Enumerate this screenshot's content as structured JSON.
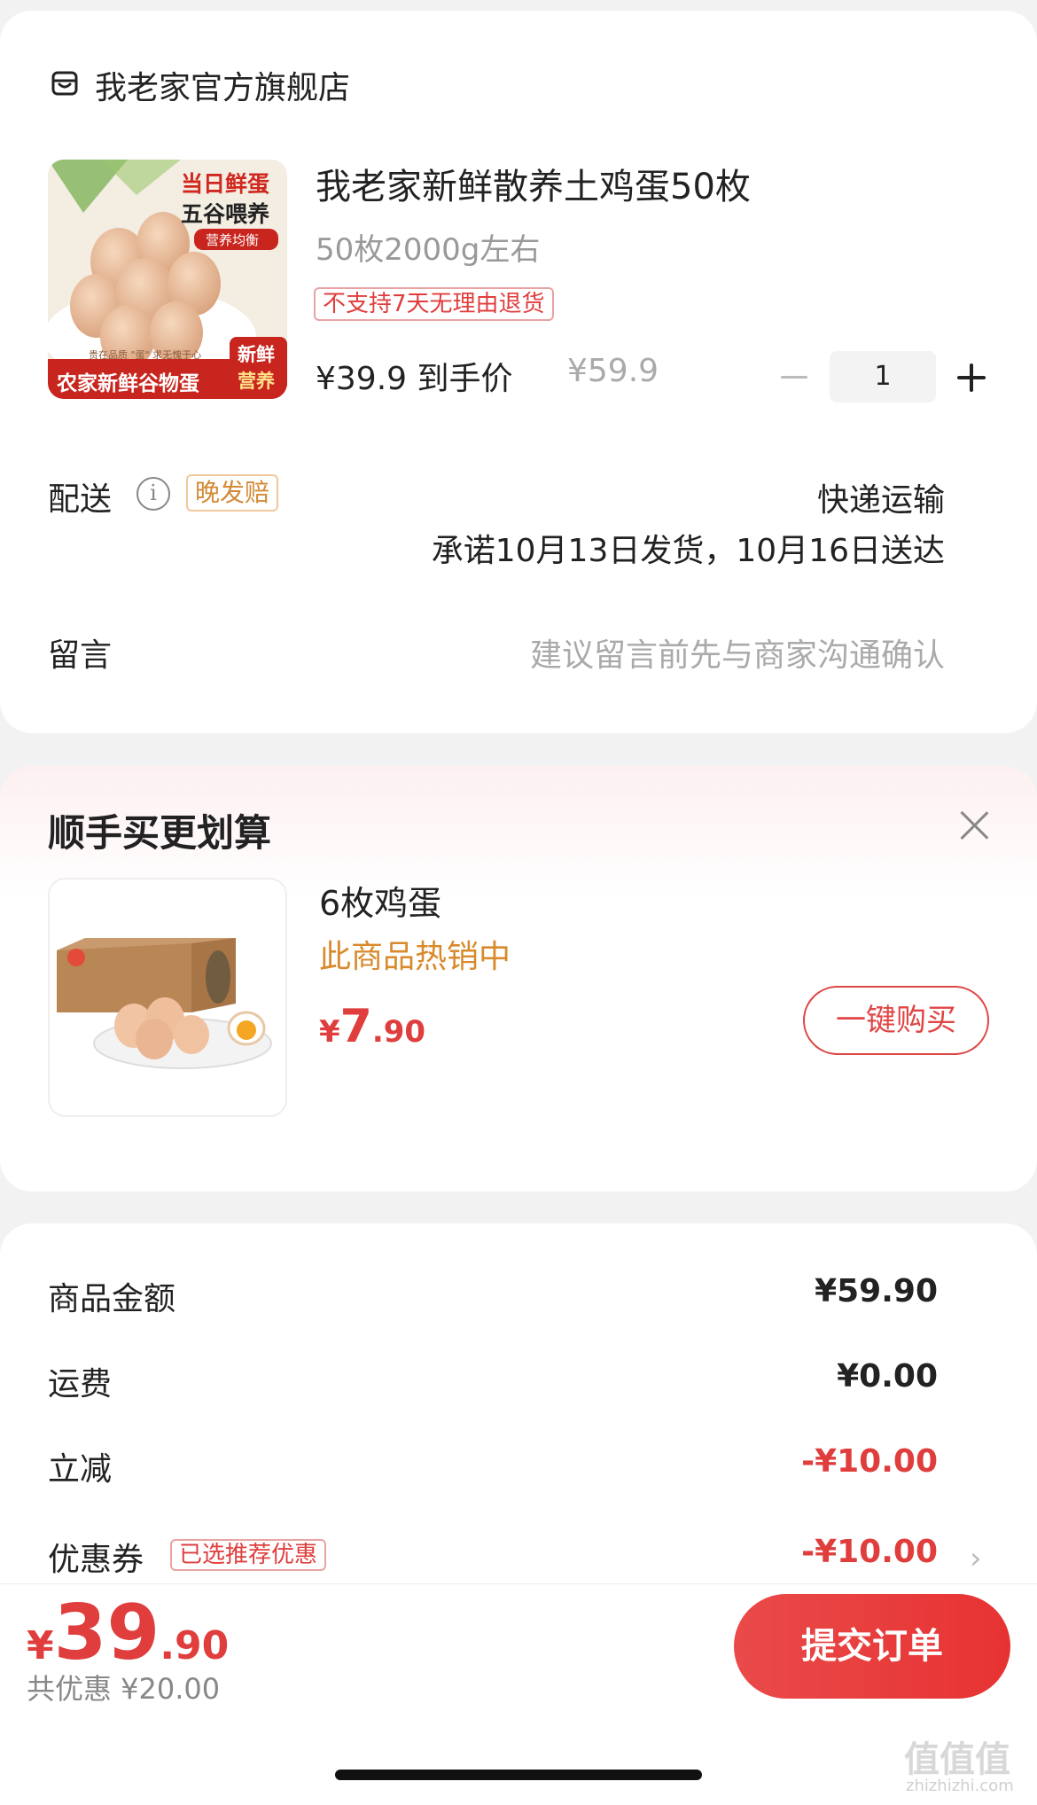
{
  "store": {
    "name": "我老家官方旗舰店",
    "icon": "store-icon"
  },
  "product": {
    "image": {
      "icon": "egg-product-image",
      "badge_line1": "当日鲜蛋",
      "badge_line2": "五谷喂养",
      "badge_line3": "营养均衡",
      "slogan": "贵在品质 \"蛋\" 求无愧于心",
      "bottom_text": "农家新鲜谷物蛋",
      "corner_line1": "新鲜",
      "corner_line2": "营养"
    },
    "title": "我老家新鲜散养土鸡蛋50枚",
    "spec": "50枚2000g左右",
    "return_tag": "不支持7天无理由退货",
    "price_label": "¥39.9 到手价",
    "original_price": "¥59.9",
    "quantity": "1"
  },
  "delivery": {
    "label": "配送",
    "info_icon": "i",
    "late_tag": "晚发赔",
    "method": "快递运输",
    "promise": "承诺10月13日发货，10月16日送达"
  },
  "message": {
    "label": "留言",
    "placeholder": "建议留言前先与商家沟通确认"
  },
  "upsell": {
    "title": "顺手买更划算",
    "item_title": "6枚鸡蛋",
    "hot_text": "此商品热销中",
    "price_currency": "¥",
    "price_int": "7",
    "price_dec": ".90",
    "buy_label": "一键购买"
  },
  "summary": {
    "goods_label": "商品金额",
    "goods_value": "¥59.90",
    "shipping_label": "运费",
    "shipping_value": "¥0.00",
    "discount_label": "立减",
    "discount_value": "-¥10.00",
    "coupon_label": "优惠券",
    "coupon_tag": "已选推荐优惠",
    "coupon_value": "-¥10.00"
  },
  "footer": {
    "currency": "¥",
    "total_int": "39",
    "total_dec": ".90",
    "saved": "共优惠 ¥20.00",
    "submit_label": "提交订单"
  },
  "watermark": {
    "main": "值值值",
    "sub": "zhizhizhi.com"
  },
  "colors": {
    "accent": "#e03d3d",
    "hot": "#d88a2c",
    "submit": "#e73232"
  }
}
